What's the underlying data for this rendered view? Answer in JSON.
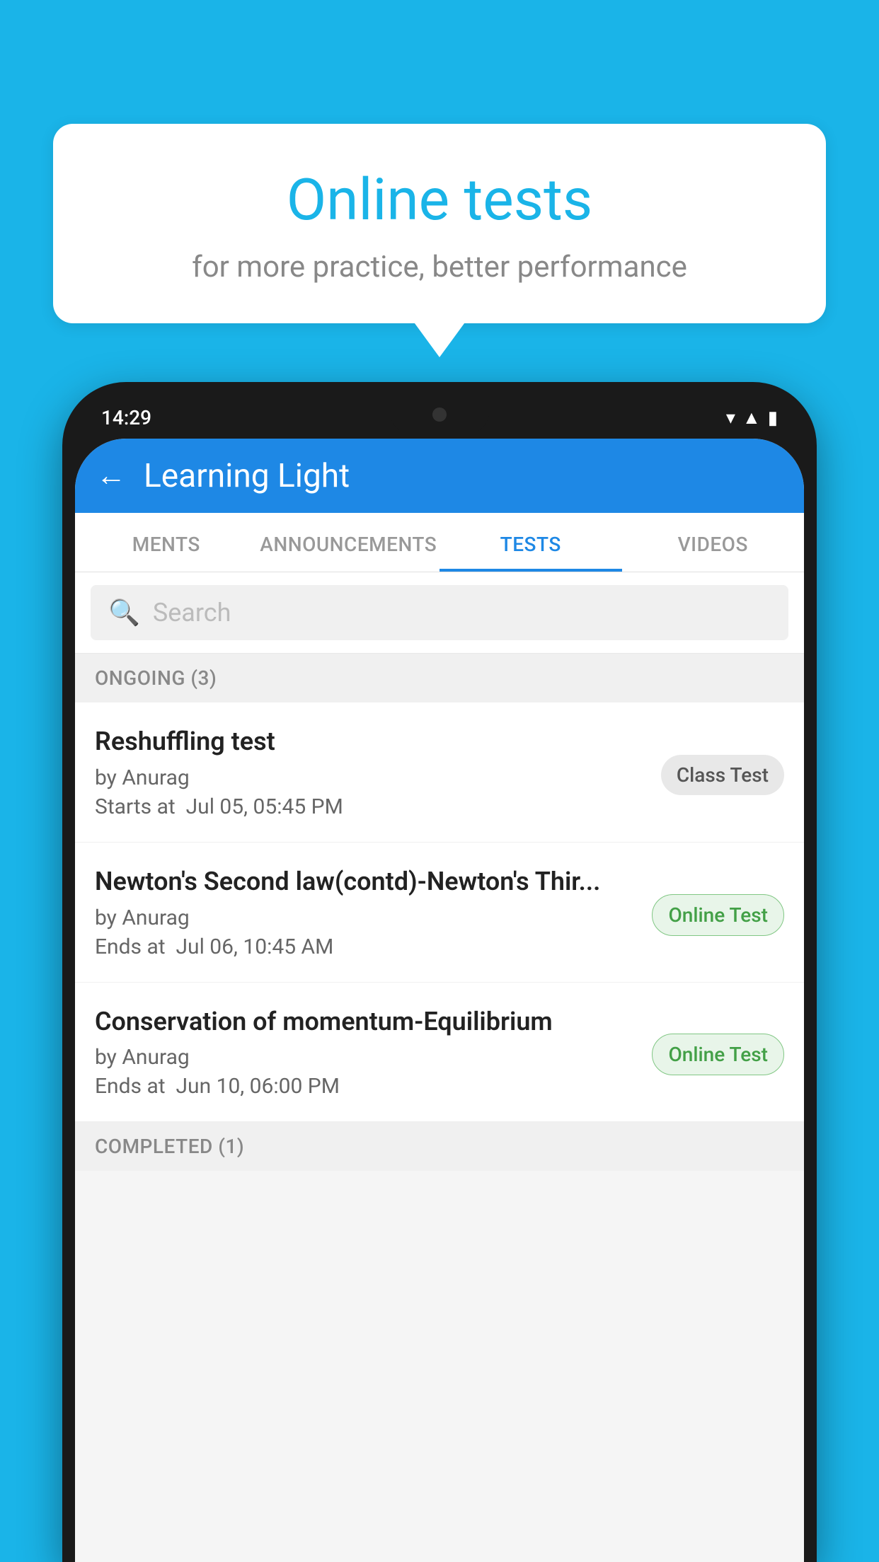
{
  "background_color": "#1ab4e8",
  "bubble": {
    "title": "Online tests",
    "subtitle": "for more practice, better performance"
  },
  "phone": {
    "time": "14:29",
    "status_icons": [
      "wifi",
      "signal",
      "battery"
    ]
  },
  "app": {
    "header_title": "Learning Light",
    "back_label": "←"
  },
  "tabs": [
    {
      "label": "MENTS",
      "active": false
    },
    {
      "label": "ANNOUNCEMENTS",
      "active": false
    },
    {
      "label": "TESTS",
      "active": true
    },
    {
      "label": "VIDEOS",
      "active": false
    }
  ],
  "search": {
    "placeholder": "Search"
  },
  "sections": [
    {
      "label": "ONGOING (3)",
      "items": [
        {
          "name": "Reshuffling test",
          "author": "by Anurag",
          "time_label": "Starts at",
          "time": "Jul 05, 05:45 PM",
          "badge": "Class Test",
          "badge_type": "class"
        },
        {
          "name": "Newton's Second law(contd)-Newton's Thir...",
          "author": "by Anurag",
          "time_label": "Ends at",
          "time": "Jul 06, 10:45 AM",
          "badge": "Online Test",
          "badge_type": "online"
        },
        {
          "name": "Conservation of momentum-Equilibrium",
          "author": "by Anurag",
          "time_label": "Ends at",
          "time": "Jun 10, 06:00 PM",
          "badge": "Online Test",
          "badge_type": "online"
        }
      ]
    }
  ],
  "completed_label": "COMPLETED (1)"
}
